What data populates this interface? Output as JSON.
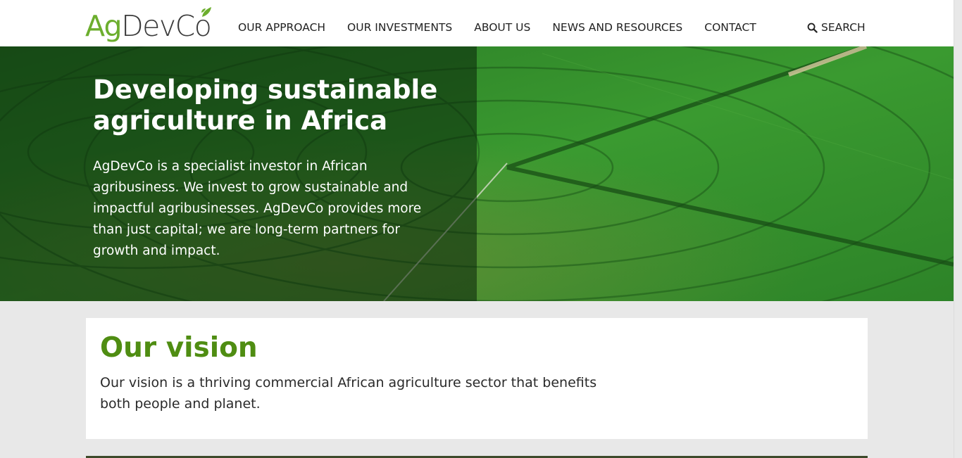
{
  "brand": {
    "logo_part1": "Ag",
    "logo_part2": "DevCo",
    "primary_green": "#6cae2e",
    "heading_green": "#4f8d12"
  },
  "nav": {
    "items": [
      {
        "label": "OUR APPROACH"
      },
      {
        "label": "OUR INVESTMENTS"
      },
      {
        "label": "ABOUT US"
      },
      {
        "label": "NEWS AND RESOURCES"
      },
      {
        "label": "CONTACT"
      }
    ],
    "search_label": "SEARCH",
    "search_icon": "search-icon"
  },
  "hero": {
    "title": "Developing sustainable agriculture in Africa",
    "text": "AgDevCo is a specialist investor in African agribusiness. We invest to grow sustainable and impactful agribusinesses. AgDevCo provides more than just capital; we are long-term partners for growth and impact."
  },
  "vision": {
    "title": "Our vision",
    "text": "Our vision is a thriving commercial African agriculture sector that benefits both people and planet."
  }
}
